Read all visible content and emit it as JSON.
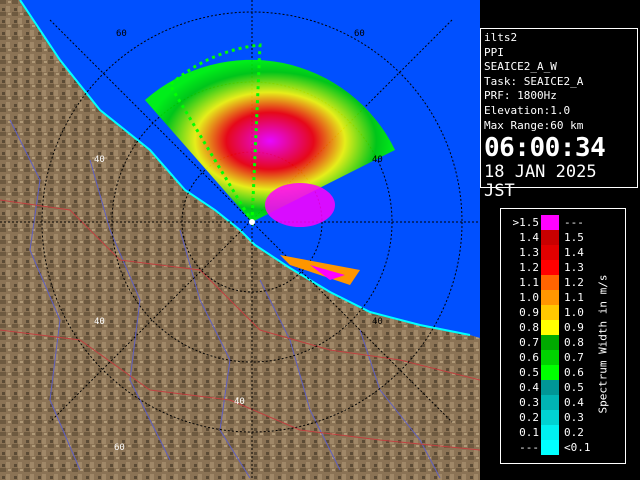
{
  "info": {
    "site": "ilts2",
    "scan_type": "PPI",
    "scan_name": "SEAICE2_A_W",
    "task": "Task: SEAICE2_A",
    "prf": "PRF: 1800Hz",
    "elevation": "Elevation:1.0",
    "max_range": "Max Range:60 km",
    "time": "06:00:34",
    "date": "18 JAN 2025 JST"
  },
  "legend": {
    "title": "Spectrum Width in m/s",
    "rows": [
      {
        "lo": ">1.5",
        "hi": "---",
        "color": "#ff00ff"
      },
      {
        "lo": "1.4",
        "hi": "1.5",
        "color": "#c80000"
      },
      {
        "lo": "1.3",
        "hi": "1.4",
        "color": "#e10000"
      },
      {
        "lo": "1.2",
        "hi": "1.3",
        "color": "#ff0000"
      },
      {
        "lo": "1.1",
        "hi": "1.2",
        "color": "#ff6400"
      },
      {
        "lo": "1.0",
        "hi": "1.1",
        "color": "#ff9600"
      },
      {
        "lo": "0.9",
        "hi": "1.0",
        "color": "#ffc800"
      },
      {
        "lo": "0.8",
        "hi": "0.9",
        "color": "#ffff00"
      },
      {
        "lo": "0.7",
        "hi": "0.8",
        "color": "#00aa00"
      },
      {
        "lo": "0.6",
        "hi": "0.7",
        "color": "#00d200"
      },
      {
        "lo": "0.5",
        "hi": "0.6",
        "color": "#00ff00"
      },
      {
        "lo": "0.4",
        "hi": "0.5",
        "color": "#009696"
      },
      {
        "lo": "0.3",
        "hi": "0.4",
        "color": "#00b4b4"
      },
      {
        "lo": "0.2",
        "hi": "0.3",
        "color": "#00d2d2"
      },
      {
        "lo": "0.1",
        "hi": "0.2",
        "color": "#00f0f0"
      },
      {
        "lo": "---",
        "hi": "<0.1",
        "color": "#00ffff"
      }
    ]
  },
  "range_labels": [
    "60",
    "60",
    "40",
    "40",
    "40",
    "40",
    "40",
    "60"
  ],
  "colors": {
    "sea": "#0050ff",
    "land": "#8b7355",
    "ring": "#000000"
  }
}
